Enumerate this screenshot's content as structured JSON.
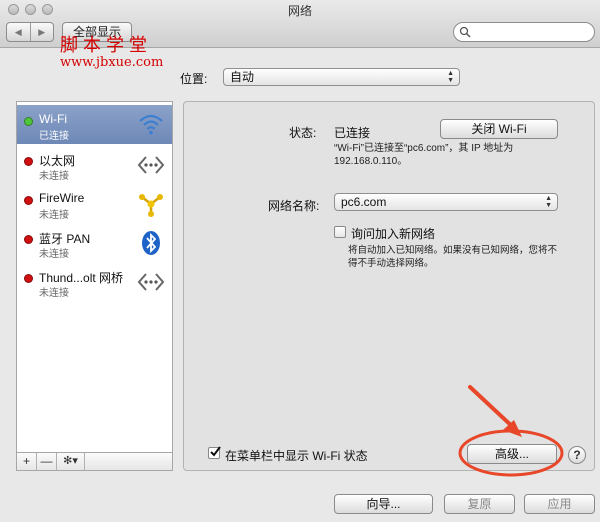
{
  "window": {
    "title": "网络"
  },
  "toolbar": {
    "back_label": "◀",
    "forward_label": "▶",
    "show_all_label": "全部显示",
    "search_placeholder": ""
  },
  "watermark": {
    "line1": "脚本学堂",
    "line2": "www.jbxue.com"
  },
  "location": {
    "label": "位置:",
    "value": "自动"
  },
  "services": [
    {
      "name": "Wi-Fi",
      "status": "已连接",
      "state_color": "#4fc53a",
      "icon": "wifi-icon"
    },
    {
      "name": "以太网",
      "status": "未连接",
      "state_color": "#d01010",
      "icon": "ethernet-icon"
    },
    {
      "name": "FireWire",
      "status": "未连接",
      "state_color": "#d01010",
      "icon": "firewire-icon"
    },
    {
      "name": "蓝牙 PAN",
      "status": "未连接",
      "state_color": "#d01010",
      "icon": "bluetooth-icon"
    },
    {
      "name": "Thund...olt 网桥",
      "status": "未连接",
      "state_color": "#d01010",
      "icon": "thunderbolt-bridge-icon"
    }
  ],
  "sidebar_footer": {
    "add": "+",
    "remove": "—",
    "gear": "✻▾"
  },
  "detail": {
    "status_label": "状态:",
    "status_value": "已连接",
    "turn_off_button": "关闭 Wi-Fi",
    "status_desc_line1": "“Wi-Fi”已连接至“pc6.com”，其 IP 地址为",
    "status_desc_line2": "192.168.0.110。",
    "network_name_label": "网络名称:",
    "network_name_value": "pc6.com",
    "ask_join_label": "询问加入新网络",
    "ask_join_desc_line1": "将自动加入已知网络。如果没有已知网络，您将不",
    "ask_join_desc_line2": "得不手动选择网络。",
    "show_in_menubar_label": "在菜单栏中显示 Wi-Fi 状态",
    "advanced_button": "高级...",
    "help_label": "?"
  },
  "bottom": {
    "assist_button": "向导...",
    "revert_button": "复原",
    "apply_button": "应用"
  },
  "colors": {
    "selection": "#7b93c0",
    "annotation": "#e8472a"
  }
}
